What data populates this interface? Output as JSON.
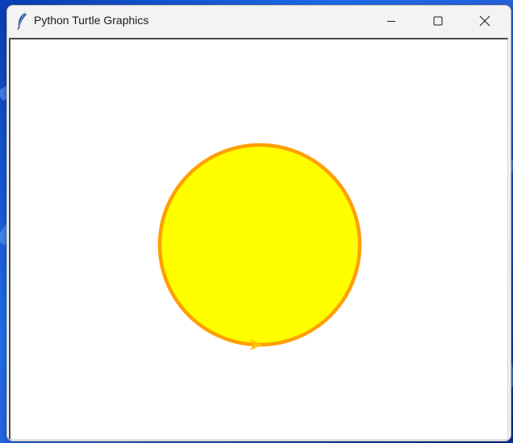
{
  "window": {
    "title": "Python Turtle Graphics",
    "icon": "feather-icon"
  },
  "caption_buttons": {
    "minimize_icon": "minimize-icon",
    "maximize_icon": "maximize-icon",
    "close_icon": "close-icon"
  },
  "canvas": {
    "background": "#ffffff",
    "drawing": {
      "shape": "circle",
      "fill_color": "#ffff00",
      "pen_color": "#ff9f00"
    },
    "turtle": {
      "shape": "arrow",
      "color": "#ffc300",
      "heading": "east"
    }
  }
}
